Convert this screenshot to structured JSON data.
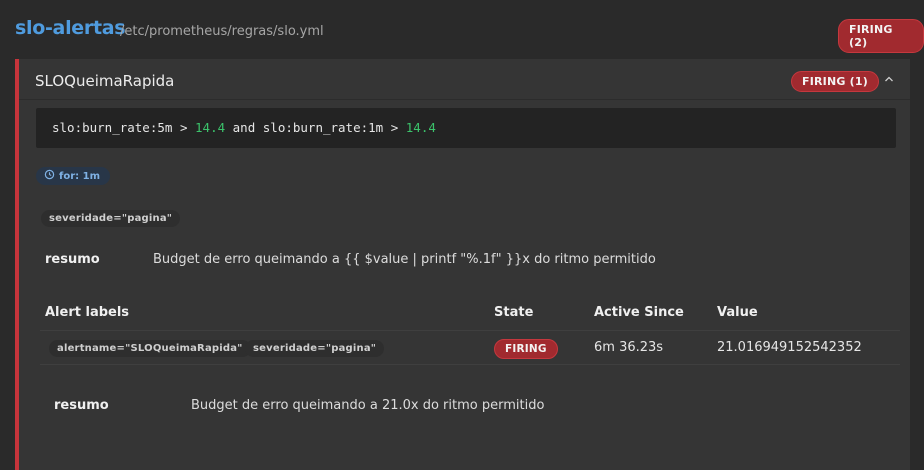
{
  "group": {
    "name": "slo-alertas",
    "file": "/etc/prometheus/regras/slo.yml",
    "badge": "FIRING (2)"
  },
  "rule": {
    "name": "SLOQueimaRapida",
    "badge": "FIRING (1)",
    "expr": {
      "part1": "slo:burn_rate:5m",
      "op1": ">",
      "num1": "14.4",
      "and": "and",
      "part2": "slo:burn_rate:1m",
      "op2": ">",
      "num2": "14.4"
    },
    "for": "for: 1m",
    "labels": [
      "severidade=\"pagina\""
    ],
    "annotation": {
      "key": "resumo",
      "value": "Budget de erro queimando a {{ $value | printf \"%.1f\" }}x do ritmo permitido"
    }
  },
  "alerts_table": {
    "headers": {
      "labels": "Alert labels",
      "state": "State",
      "active_since": "Active Since",
      "value": "Value"
    },
    "rows": [
      {
        "labels": [
          "alertname=\"SLOQueimaRapida\"",
          "severidade=\"pagina\""
        ],
        "state": "FIRING",
        "active_since": "6m 36.23s",
        "value": "21.016949152542352",
        "annotation": {
          "key": "resumo",
          "value": "Budget de erro queimando a 21.0x do ritmo permitido"
        }
      }
    ]
  },
  "colors": {
    "accent": "#4f9bde",
    "firing": "#a12a2f",
    "number": "#3bc36b"
  },
  "icons": {
    "collapse": "chevron-up-icon",
    "for": "clock-icon"
  }
}
